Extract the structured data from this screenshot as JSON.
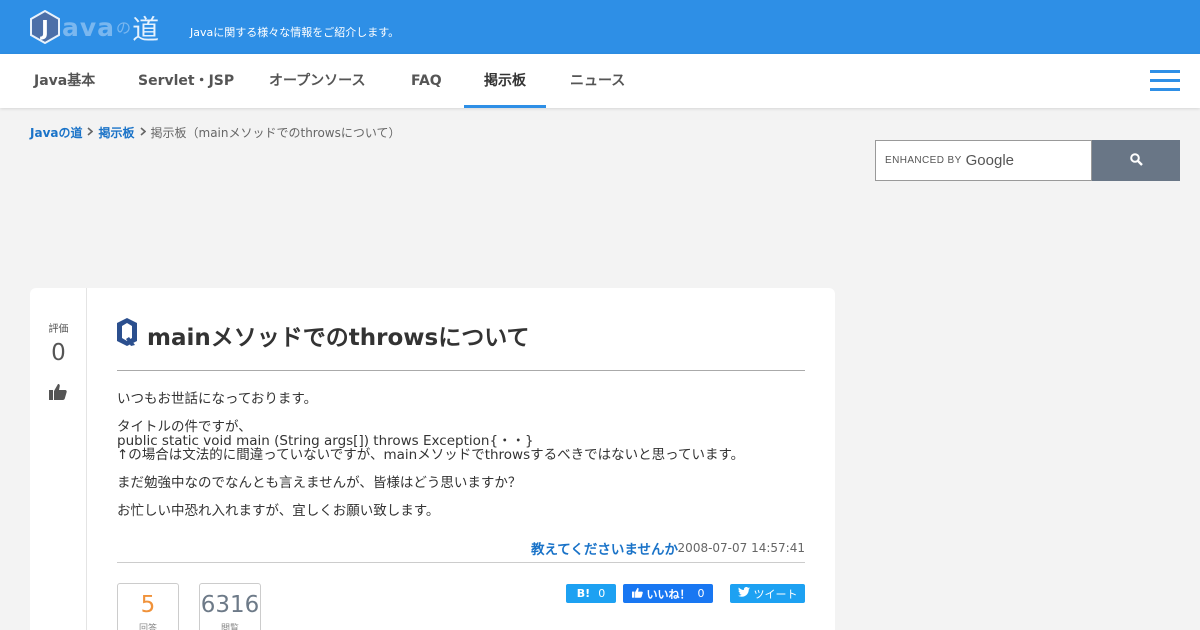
{
  "header": {
    "logo_letter": "J",
    "logo_word": "ava",
    "logo_no": "の",
    "logo_michi": "道",
    "tagline": "Javaに関する様々な情報をご紹介します。"
  },
  "nav": {
    "items": [
      {
        "label": "Java基本"
      },
      {
        "label": "Servlet・JSP"
      },
      {
        "label": "オープンソース"
      },
      {
        "label": "FAQ"
      },
      {
        "label": "掲示板"
      },
      {
        "label": "ニュース"
      }
    ],
    "active": "掲示板"
  },
  "breadcrumb": {
    "home": "Javaの道",
    "section": "掲示板",
    "current": "掲示板（mainメソッドでのthrowsについて）"
  },
  "search": {
    "enhanced_by": "ENHANCED BY",
    "brand": "Google"
  },
  "question": {
    "vote_label": "評価",
    "vote_count": "0",
    "title": "mainメソッドでのthrowsについて",
    "body": [
      "いつもお世話になっております。",
      "タイトルの件ですが、",
      "public static void main (String args[]) throws Exception{・・}",
      "↑の場合は文法的に間違っていないですが、mainメソッドでthrowsするべきではないと思っています。",
      "まだ勉強中なのでなんとも言えませんが、皆様はどう思いますか？",
      "お忙しい中恐れ入れますが、宜しくお願い致します。"
    ],
    "author": "教えてくださいませんか",
    "date": "2008-07-07 14:57:41"
  },
  "stats": {
    "answers": "5",
    "answers_label": "回答",
    "views": "6316",
    "views_label": "閲覧"
  },
  "share": {
    "hatena_icon": "B!",
    "hatena_count": "0",
    "fb_label": "いいね！",
    "fb_count": "0",
    "tweet_label": "ツイート"
  },
  "colors": {
    "brand_blue": "#2e8fe6",
    "link_blue": "#1a73c8",
    "answer_orange": "#f0923a",
    "hatena": "#1da1f2",
    "facebook": "#1877f2",
    "twitter": "#1da1f2"
  }
}
